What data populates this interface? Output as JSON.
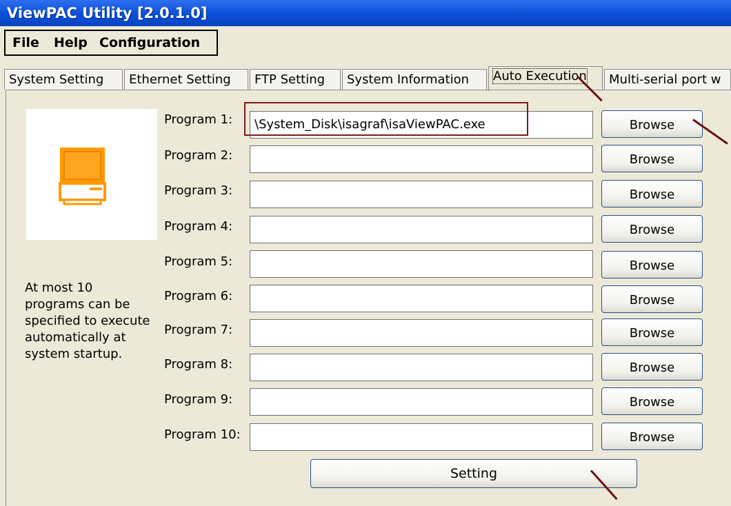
{
  "window": {
    "title": "ViewPAC Utility [2.0.1.0]"
  },
  "menu": [
    "File",
    "Help",
    "Configuration"
  ],
  "tabs": [
    {
      "label": "System Setting",
      "active": false
    },
    {
      "label": "Ethernet Setting",
      "active": false
    },
    {
      "label": "FTP Setting",
      "active": false
    },
    {
      "label": "System Information",
      "active": false
    },
    {
      "label": "Auto Execution",
      "active": true
    },
    {
      "label": "Multi-serial port w",
      "active": false
    }
  ],
  "icon": {
    "name": "computer-icon",
    "color": "#ff9900"
  },
  "help_text": "At most 10 programs can be specified to execute automatically at system startup.",
  "programs": [
    {
      "label": "Program 1:",
      "value": "\\System_Disk\\isagraf\\isaViewPAC.exe"
    },
    {
      "label": "Program 2:",
      "value": ""
    },
    {
      "label": "Program 3:",
      "value": ""
    },
    {
      "label": "Program 4:",
      "value": ""
    },
    {
      "label": "Program 5:",
      "value": ""
    },
    {
      "label": "Program 6:",
      "value": ""
    },
    {
      "label": "Program 7:",
      "value": ""
    },
    {
      "label": "Program 8:",
      "value": ""
    },
    {
      "label": "Program 9:",
      "value": ""
    },
    {
      "label": "Program 10:",
      "value": ""
    }
  ],
  "browse_label": "Browse",
  "setting_label": "Setting",
  "colors": {
    "titlebar": "#0a4fd8",
    "window_bg": "#ece9d8",
    "annotation": "#7a1a1a"
  }
}
